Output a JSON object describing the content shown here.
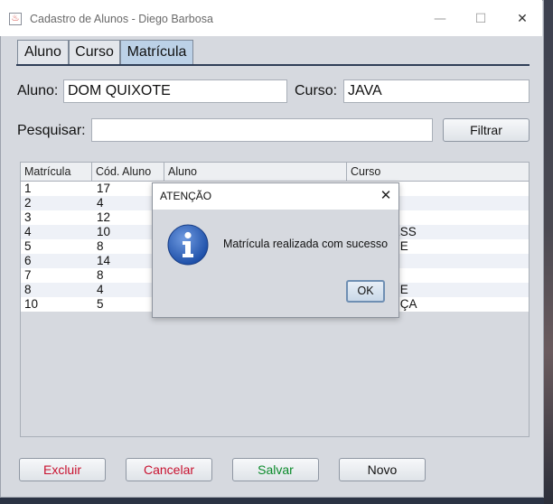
{
  "window": {
    "title": "Cadastro de Alunos - Diego Barbosa",
    "icon": "java-cup-icon",
    "controls": {
      "minimize": "—",
      "maximize": "☐",
      "close": "✕"
    }
  },
  "tabs": [
    {
      "label": "Aluno",
      "active": false
    },
    {
      "label": "Curso",
      "active": false
    },
    {
      "label": "Matrícula",
      "active": true
    }
  ],
  "form": {
    "aluno_label": "Aluno:",
    "aluno_value": "DOM QUIXOTE",
    "curso_label": "Curso:",
    "curso_value": "JAVA",
    "pesquisar_label": "Pesquisar:",
    "pesquisar_value": "",
    "filtrar_label": "Filtrar"
  },
  "table": {
    "headers": [
      "Matrícula",
      "Cód. Aluno",
      "Aluno",
      "Curso"
    ],
    "rows": [
      [
        "1",
        "17",
        "",
        ""
      ],
      [
        "2",
        "4",
        "",
        ""
      ],
      [
        "3",
        "12",
        "",
        "A"
      ],
      [
        "4",
        "10",
        "",
        "RESS"
      ],
      [
        "5",
        "8",
        "",
        "ARE"
      ],
      [
        "6",
        "14",
        "",
        ""
      ],
      [
        "7",
        "8",
        "",
        ""
      ],
      [
        "8",
        "4",
        "",
        "ARE"
      ],
      [
        "10",
        "5",
        "",
        "ANÇA"
      ]
    ]
  },
  "buttons": {
    "excluir": "Excluir",
    "cancelar": "Cancelar",
    "salvar": "Salvar",
    "novo": "Novo"
  },
  "dialog": {
    "title": "ATENÇÃO",
    "close": "✕",
    "message": "Matrícula realizada com sucesso",
    "ok": "OK",
    "icon": "info-icon"
  },
  "colors": {
    "excluir_text": "#c8102e",
    "cancelar_text": "#c8102e",
    "salvar_text": "#0a8a2a",
    "active_tab": "#bcd1e7",
    "info_icon": "#2e62b8"
  }
}
